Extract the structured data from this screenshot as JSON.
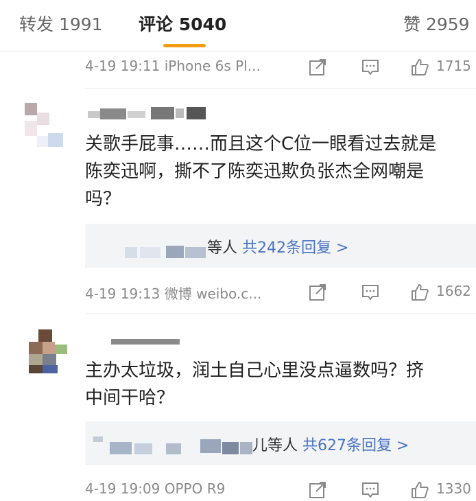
{
  "tabs": {
    "repost": "转发 1991",
    "comments": "评论 5040",
    "likes": "赞 2959"
  },
  "comments": [
    {
      "meta": "4-19 19:11  iPhone 6s Pl...",
      "like_count": "1715"
    },
    {
      "text_lines": [
        "关歌手屁事……而且这个C位一眼看过去就是",
        "陈奕迅啊，撕不了陈奕迅欺负张杰全网嘲是",
        "吗？"
      ],
      "reply_suffix": "等人",
      "reply_total": "共242条回复 >",
      "meta": "4-19 19:13  微博 weibo.c...",
      "like_count": "1662"
    },
    {
      "text_lines": [
        "主办太垃圾，润土自己心里没点逼数吗？挤",
        "中间干哈？"
      ],
      "reply_suffix": "儿等人",
      "reply_total": "共627条回复 >",
      "meta": "4-19 19:09  OPPO R9",
      "like_count": "1330"
    }
  ],
  "colors": {
    "accent": "#f39c12",
    "link": "#4a74c4"
  },
  "icons": [
    "share-icon",
    "comment-icon",
    "like-icon"
  ]
}
